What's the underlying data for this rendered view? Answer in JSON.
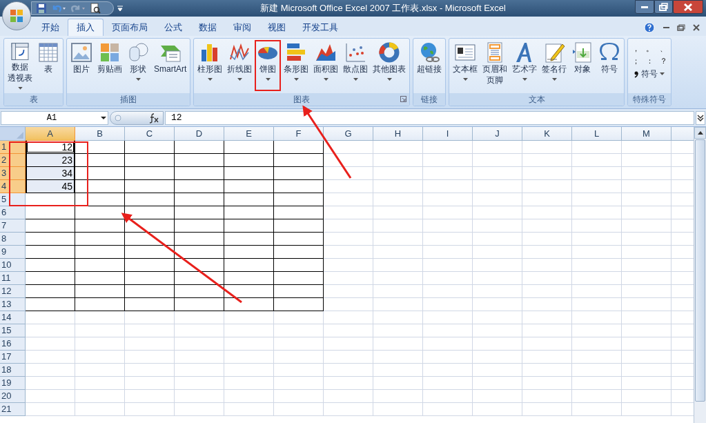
{
  "window": {
    "title": "新建 Microsoft Office Excel 2007 工作表.xlsx  -  Microsoft Excel"
  },
  "tabs": [
    {
      "label": "开始",
      "selected": false
    },
    {
      "label": "插入",
      "selected": true
    },
    {
      "label": "页面布局",
      "selected": false
    },
    {
      "label": "公式",
      "selected": false
    },
    {
      "label": "数据",
      "selected": false
    },
    {
      "label": "审阅",
      "selected": false
    },
    {
      "label": "视图",
      "selected": false
    },
    {
      "label": "开发工具",
      "selected": false
    }
  ],
  "ribbon_groups": [
    {
      "label": "表",
      "buttons": [
        {
          "kind": "pivot",
          "lines": [
            "数据",
            "透视表"
          ],
          "dropdown": true,
          "highlighted": false
        },
        {
          "kind": "table",
          "lines": [
            "表"
          ],
          "dropdown": false,
          "highlighted": false
        }
      ]
    },
    {
      "label": "插图",
      "buttons": [
        {
          "kind": "picture",
          "lines": [
            "图片"
          ],
          "dropdown": false,
          "highlighted": false
        },
        {
          "kind": "clipart",
          "lines": [
            "剪贴画"
          ],
          "dropdown": false,
          "highlighted": false
        },
        {
          "kind": "shapes",
          "lines": [
            "形状"
          ],
          "dropdown": true,
          "highlighted": false
        },
        {
          "kind": "smartart",
          "lines": [
            "SmartArt"
          ],
          "dropdown": false,
          "highlighted": false
        }
      ]
    },
    {
      "label": "图表",
      "launcher": true,
      "buttons": [
        {
          "kind": "column",
          "lines": [
            "柱形图"
          ],
          "dropdown": true,
          "highlighted": false
        },
        {
          "kind": "line",
          "lines": [
            "折线图"
          ],
          "dropdown": true,
          "highlighted": false
        },
        {
          "kind": "pie",
          "lines": [
            "饼图"
          ],
          "dropdown": true,
          "highlighted": true
        },
        {
          "kind": "bar",
          "lines": [
            "条形图"
          ],
          "dropdown": true,
          "highlighted": false
        },
        {
          "kind": "area",
          "lines": [
            "面积图"
          ],
          "dropdown": true,
          "highlighted": false
        },
        {
          "kind": "scatter",
          "lines": [
            "散点图"
          ],
          "dropdown": true,
          "highlighted": false
        },
        {
          "kind": "donut",
          "lines": [
            "其他图表"
          ],
          "dropdown": true,
          "highlighted": false
        }
      ]
    },
    {
      "label": "链接",
      "buttons": [
        {
          "kind": "hyperlink",
          "lines": [
            "超链接"
          ],
          "dropdown": false,
          "highlighted": false
        }
      ]
    },
    {
      "label": "文本",
      "buttons": [
        {
          "kind": "textbox",
          "lines": [
            "文本框"
          ],
          "dropdown": true,
          "highlighted": false
        },
        {
          "kind": "header",
          "lines": [
            "页眉和",
            "页脚"
          ],
          "dropdown": false,
          "highlighted": false
        },
        {
          "kind": "wordart",
          "lines": [
            "艺术字"
          ],
          "dropdown": true,
          "highlighted": false
        },
        {
          "kind": "signature",
          "lines": [
            "签名行"
          ],
          "dropdown": true,
          "highlighted": false
        },
        {
          "kind": "object",
          "lines": [
            "对象"
          ],
          "dropdown": false,
          "highlighted": false
        },
        {
          "kind": "symbol",
          "lines": [
            "符号"
          ],
          "dropdown": false,
          "highlighted": false
        }
      ]
    },
    {
      "label": "特殊符号",
      "symbols": [
        "，",
        "。",
        "、",
        "；",
        "：",
        "？"
      ],
      "menu_label": "符号"
    }
  ],
  "formula_bar": {
    "name_box": "A1",
    "formula": "12"
  },
  "sheet": {
    "highlighted": true,
    "columns": [
      {
        "label": "A",
        "selected": true
      },
      {
        "label": "B",
        "selected": false
      },
      {
        "label": "C",
        "selected": false
      },
      {
        "label": "D",
        "selected": false
      },
      {
        "label": "E",
        "selected": false
      },
      {
        "label": "F",
        "selected": false
      },
      {
        "label": "G",
        "selected": false
      },
      {
        "label": "H",
        "selected": false
      },
      {
        "label": "I",
        "selected": false
      },
      {
        "label": "J",
        "selected": false
      },
      {
        "label": "K",
        "selected": false
      },
      {
        "label": "L",
        "selected": false
      },
      {
        "label": "M",
        "selected": false
      }
    ],
    "rows": [
      {
        "label": "1",
        "selected": true,
        "bordered": true,
        "cells": [
          {
            "value": "12",
            "selected": true,
            "active": true
          }
        ]
      },
      {
        "label": "2",
        "selected": true,
        "bordered": true,
        "cells": [
          {
            "value": "23",
            "selected": true,
            "active": false
          }
        ]
      },
      {
        "label": "3",
        "selected": true,
        "bordered": true,
        "cells": [
          {
            "value": "34",
            "selected": true,
            "active": false
          }
        ]
      },
      {
        "label": "4",
        "selected": true,
        "bordered": true,
        "cells": [
          {
            "value": "45",
            "selected": true,
            "active": false
          }
        ]
      },
      {
        "label": "5",
        "selected": false,
        "bordered": true
      },
      {
        "label": "6",
        "selected": false,
        "bordered": true
      },
      {
        "label": "7",
        "selected": false,
        "bordered": true
      },
      {
        "label": "8",
        "selected": false,
        "bordered": true
      },
      {
        "label": "9",
        "selected": false,
        "bordered": true
      },
      {
        "label": "10",
        "selected": false,
        "bordered": true
      },
      {
        "label": "11",
        "selected": false,
        "bordered": true
      },
      {
        "label": "12",
        "selected": false,
        "bordered": true
      },
      {
        "label": "13",
        "selected": false,
        "bordered": true
      },
      {
        "label": "14",
        "selected": false,
        "bordered": false
      },
      {
        "label": "15",
        "selected": false,
        "bordered": false
      },
      {
        "label": "16",
        "selected": false,
        "bordered": false
      },
      {
        "label": "17",
        "selected": false,
        "bordered": false
      },
      {
        "label": "18",
        "selected": false,
        "bordered": false
      },
      {
        "label": "19",
        "selected": false,
        "bordered": false
      },
      {
        "label": "20",
        "selected": false,
        "bordered": false
      },
      {
        "label": "21",
        "selected": false,
        "bordered": false
      }
    ]
  }
}
